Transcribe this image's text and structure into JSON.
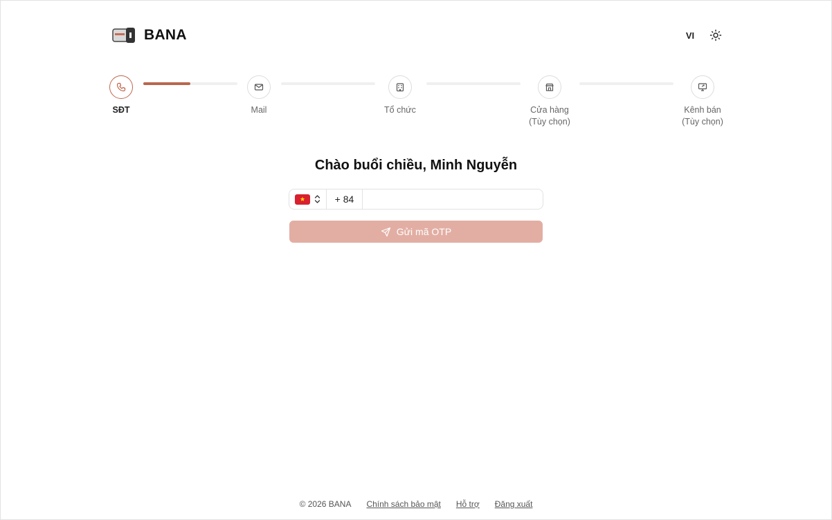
{
  "brand": {
    "name": "BANA",
    "logo_icon": "card-wallet-icon"
  },
  "header": {
    "language": "VI",
    "theme_icon": "sun-icon"
  },
  "stepper": {
    "progress_first_segment": 0.5,
    "accent_color": "#b8674d",
    "steps": [
      {
        "label": "SĐT",
        "sub": "",
        "icon": "phone-icon",
        "active": true
      },
      {
        "label": "Mail",
        "sub": "",
        "icon": "mail-icon",
        "active": false
      },
      {
        "label": "Tổ chức",
        "sub": "",
        "icon": "building-icon",
        "active": false
      },
      {
        "label": "Cửa hàng",
        "sub": "(Tùy chọn)",
        "icon": "store-icon",
        "active": false
      },
      {
        "label": "Kênh bán",
        "sub": "(Tùy chọn)",
        "icon": "monitor-share-icon",
        "active": false
      }
    ]
  },
  "greeting": "Chào buổi chiều, Minh Nguyễn",
  "phone_input": {
    "country_flag": "vietnam-flag",
    "flag_star": "★",
    "dial_code": "+ 84",
    "value": "",
    "placeholder": ""
  },
  "otp_button": {
    "label": "Gửi mã OTP",
    "icon": "send-icon",
    "color": "#e2aea3"
  },
  "footer": {
    "copyright": "© 2026 BANA",
    "links": [
      "Chính sách bảo mật",
      "Hỗ trợ",
      "Đăng xuất"
    ]
  }
}
